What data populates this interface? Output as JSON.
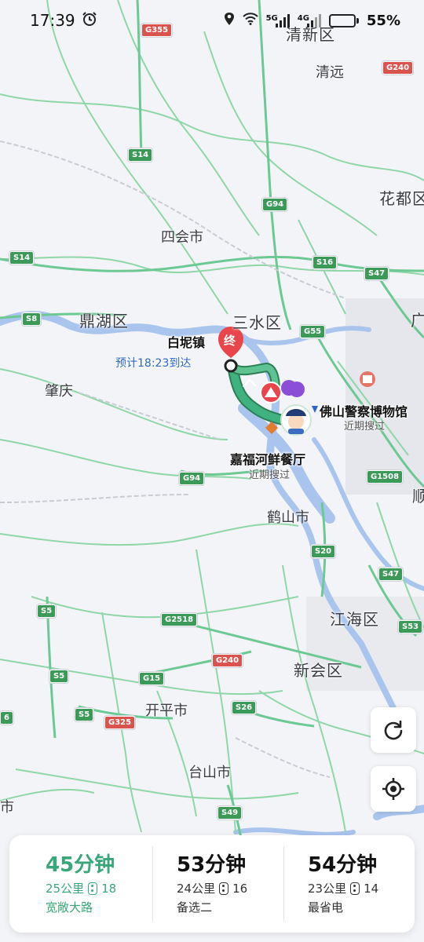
{
  "status": {
    "time": "17:39",
    "net_a": "5G",
    "net_b": "4G",
    "battery": "55%",
    "battery_level": 0.55
  },
  "map": {
    "places": [
      {
        "name": "清新区",
        "key": "qingxin"
      },
      {
        "name": "清远",
        "key": "qingyuan"
      },
      {
        "name": "花都区",
        "key": "huadu"
      },
      {
        "name": "四会市",
        "key": "sihui"
      },
      {
        "name": "鼎湖区",
        "key": "dinghu"
      },
      {
        "name": "三水区",
        "key": "sanshui"
      },
      {
        "name": "肇庆",
        "key": "zhaoqing"
      },
      {
        "name": "鹤山市",
        "key": "heshan"
      },
      {
        "name": "江海区",
        "key": "jianghai"
      },
      {
        "name": "新会区",
        "key": "xinhui"
      },
      {
        "name": "开平市",
        "key": "kaiping"
      },
      {
        "name": "台山市",
        "key": "taishan"
      },
      {
        "name": "广",
        "key": "guang"
      },
      {
        "name": "顺",
        "key": "shun"
      },
      {
        "name": "市",
        "key": "shi"
      }
    ],
    "shields": [
      "G355",
      "G240",
      "S14",
      "G94",
      "S14",
      "S16",
      "S47",
      "S8",
      "G55",
      "G1508",
      "G94",
      "S20",
      "S47",
      "S5",
      "G2518",
      "S53",
      "G240",
      "S5",
      "G15",
      "S26",
      "S5",
      "G325",
      "S49",
      "6"
    ],
    "destination": {
      "name": "白坭镇",
      "marker": "终",
      "eta": "预计18:23到达"
    },
    "pois": [
      {
        "title": "佛山警察博物馆",
        "sub": "近期搜过"
      },
      {
        "title": "嘉福河鲜餐厅",
        "sub": "近期搜过"
      }
    ]
  },
  "controls": {
    "refresh_icon": "refresh-icon",
    "locate_icon": "locate-icon"
  },
  "routes": [
    {
      "time": "45分钟",
      "distance": "25公里",
      "lights": "18",
      "tag": "宽敞大路",
      "active": true
    },
    {
      "time": "53分钟",
      "distance": "24公里",
      "lights": "16",
      "tag": "备选二",
      "active": false
    },
    {
      "time": "54分钟",
      "distance": "23公里",
      "lights": "14",
      "tag": "最省电",
      "active": false
    }
  ],
  "colors": {
    "route": "#3fb27f",
    "active_text": "#3aa77a",
    "destination_pin": "#e8464b",
    "eta_text": "#2b66c9",
    "river": "#a9c5ee"
  }
}
